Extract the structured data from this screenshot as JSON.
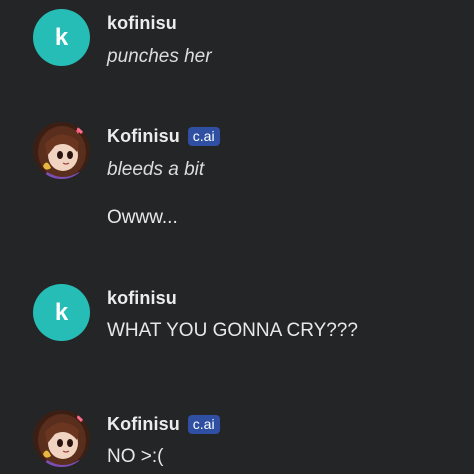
{
  "messages": [
    {
      "sender": "kofinisu",
      "avatar_letter": "k",
      "lines": [
        "punches her"
      ]
    },
    {
      "sender": "Kofinisu",
      "badge": "c.ai",
      "lines": [
        "bleeds a bit",
        "Owww..."
      ]
    },
    {
      "sender": "kofinisu",
      "avatar_letter": "k",
      "lines": [
        "WHAT YOU GONNA CRY???"
      ]
    },
    {
      "sender": "Kofinisu",
      "badge": "c.ai",
      "lines": [
        "NO >:("
      ]
    }
  ],
  "colors": {
    "background": "#242526",
    "user_avatar": "#26bdb6",
    "badge": "#2f4fa3"
  },
  "icons": {
    "bot_avatar": "anime-girl-avatar-image"
  }
}
